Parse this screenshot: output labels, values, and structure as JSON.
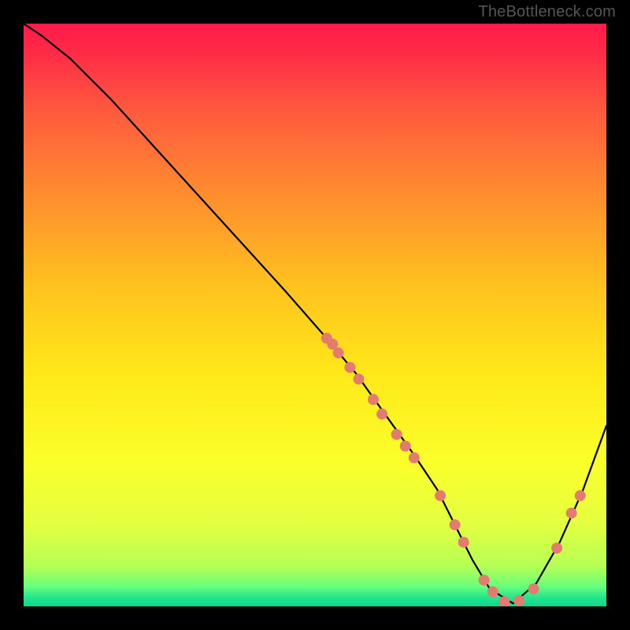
{
  "watermark": "TheBottleneck.com",
  "chart_data": {
    "type": "line",
    "title": "",
    "xlabel": "",
    "ylabel": "",
    "xlim": [
      0,
      100
    ],
    "ylim": [
      0,
      100
    ],
    "curve": {
      "name": "bottleneck-curve",
      "x": [
        0,
        3,
        8,
        15,
        25,
        35,
        45,
        52,
        57,
        62,
        67,
        71,
        74,
        77,
        80,
        84,
        88,
        92,
        96,
        100
      ],
      "y": [
        100,
        98,
        94,
        87,
        76,
        65,
        54,
        46,
        40,
        33,
        26,
        20,
        14,
        8,
        3,
        0.5,
        4,
        11,
        20,
        31
      ]
    },
    "dots_on_curve": [
      {
        "x": 52,
        "y": 46
      },
      {
        "x": 53,
        "y": 45
      },
      {
        "x": 54,
        "y": 43.5
      },
      {
        "x": 56,
        "y": 41
      },
      {
        "x": 57.5,
        "y": 39
      },
      {
        "x": 60,
        "y": 35.5
      },
      {
        "x": 61.5,
        "y": 33
      },
      {
        "x": 64,
        "y": 29.5
      },
      {
        "x": 65.5,
        "y": 27.5
      },
      {
        "x": 67,
        "y": 25.5
      },
      {
        "x": 71.5,
        "y": 19
      },
      {
        "x": 74,
        "y": 14
      },
      {
        "x": 75.5,
        "y": 11
      },
      {
        "x": 79,
        "y": 4.5
      },
      {
        "x": 80.5,
        "y": 2.5
      },
      {
        "x": 82.5,
        "y": 0.8
      },
      {
        "x": 85,
        "y": 1
      },
      {
        "x": 87.5,
        "y": 3
      },
      {
        "x": 91.5,
        "y": 10
      },
      {
        "x": 94,
        "y": 16
      },
      {
        "x": 95.5,
        "y": 19
      }
    ],
    "gradient_stops": [
      {
        "offset": 0,
        "color": "#ff1a4a"
      },
      {
        "offset": 0.05,
        "color": "#ff2b46"
      },
      {
        "offset": 0.15,
        "color": "#ff5a3e"
      },
      {
        "offset": 0.3,
        "color": "#ff8f2e"
      },
      {
        "offset": 0.45,
        "color": "#ffc21e"
      },
      {
        "offset": 0.6,
        "color": "#ffe81a"
      },
      {
        "offset": 0.75,
        "color": "#fbff2a"
      },
      {
        "offset": 0.86,
        "color": "#e3ff40"
      },
      {
        "offset": 0.93,
        "color": "#b6ff55"
      },
      {
        "offset": 0.965,
        "color": "#6bff7a"
      },
      {
        "offset": 0.985,
        "color": "#22e58f"
      },
      {
        "offset": 1.0,
        "color": "#0fd68a"
      }
    ],
    "dot_color": "#e47b71",
    "curve_color": "#000000"
  }
}
